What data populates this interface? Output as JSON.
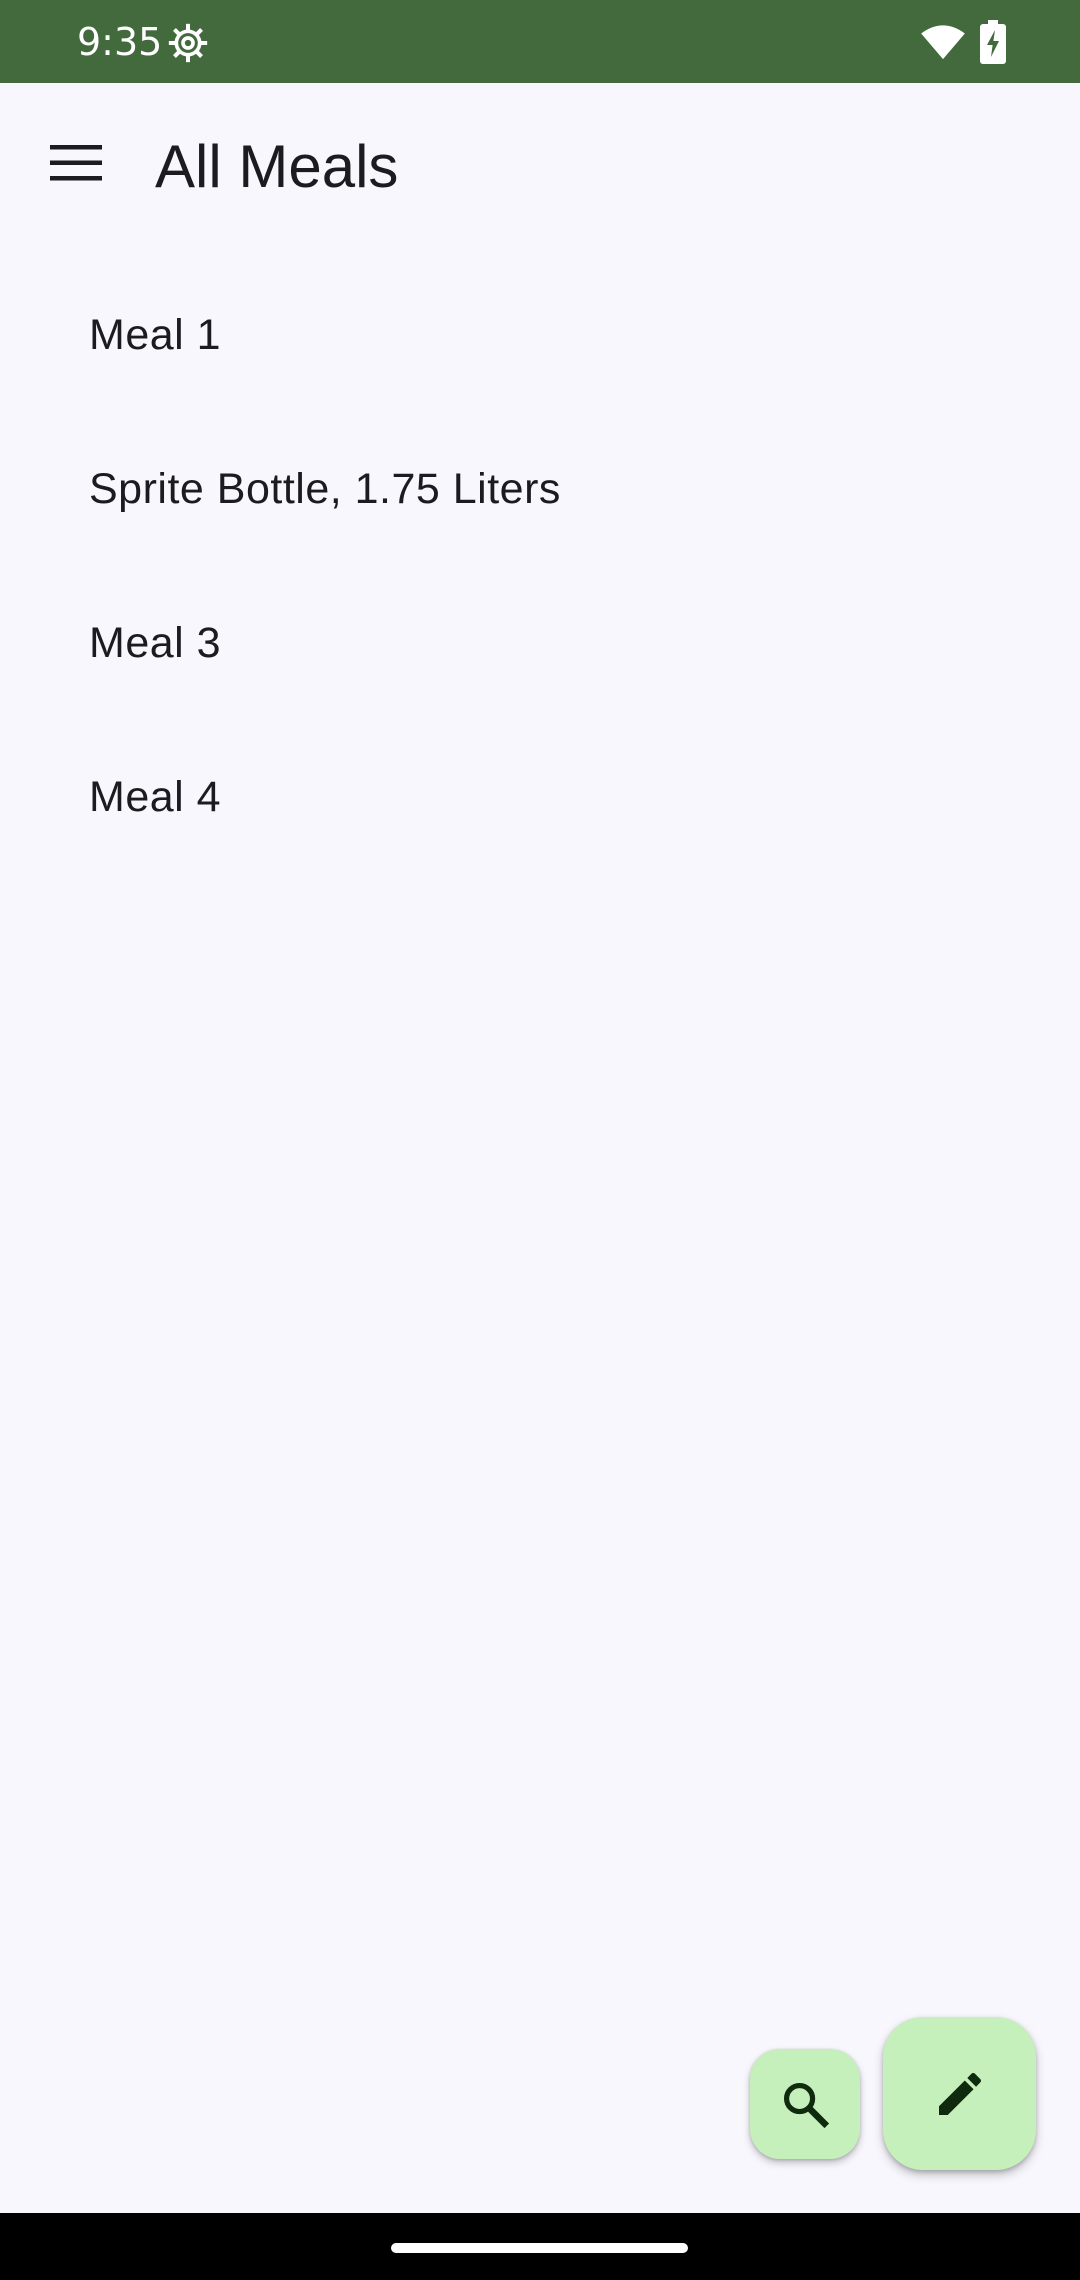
{
  "status_bar": {
    "time": "9:35",
    "background": "#436a3d",
    "icons": [
      "settings-gear-icon",
      "wifi-icon",
      "battery-charging-icon"
    ]
  },
  "app_bar": {
    "title": "All Meals",
    "menu_icon": "hamburger-menu-icon"
  },
  "meals": [
    {
      "name": "Meal 1"
    },
    {
      "name": "Sprite Bottle, 1.75 Liters"
    },
    {
      "name": "Meal 3"
    },
    {
      "name": "Meal 4"
    }
  ],
  "fabs": {
    "search_icon": "search-icon",
    "edit_icon": "pencil-icon",
    "color": "#c5efbb"
  }
}
